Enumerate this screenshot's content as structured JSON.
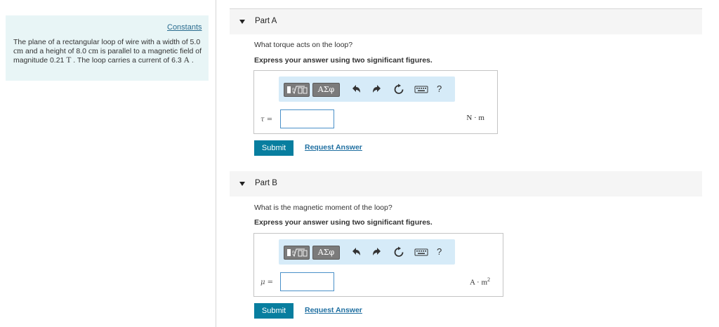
{
  "sidebar": {
    "constants_link": "Constants",
    "problem": {
      "t1": "The plane of a rectangular loop of wire with a width of 5.0",
      "u1": "cm",
      "t2": " and a height of 8.0 ",
      "u2": "cm",
      "t3": " is parallel to a magnetic field of magnitude 0.21 ",
      "u3": "T",
      "t4": " . The loop carries a current of 6.3 ",
      "u4": "A",
      "t5": " ."
    }
  },
  "parts": [
    {
      "title": "Part A",
      "question": "What torque acts on the loop?",
      "instruction": "Express your answer using two significant figures.",
      "variable_label": "τ =",
      "input_value": "",
      "unit": "N · m",
      "submit_label": "Submit",
      "request_label": "Request Answer"
    },
    {
      "title": "Part B",
      "question": "What is the magnetic moment of the loop?",
      "instruction": "Express your answer using two significant figures.",
      "variable_label": "μ =",
      "input_value": "",
      "unit_base": "A · m",
      "unit_exp": "2",
      "submit_label": "Submit",
      "request_label": "Request Answer"
    }
  ],
  "toolbar": {
    "greek_label": "ΑΣφ",
    "help_label": "?",
    "icons": [
      "templates-icon",
      "greek-symbols-icon",
      "undo-icon",
      "redo-icon",
      "reset-icon",
      "keyboard-icon",
      "help-icon"
    ]
  },
  "colors": {
    "panel_bg": "#e8f5f6",
    "toolbar_bg": "#d6ebf8",
    "submit_bg": "#087e9f",
    "link": "#1f6fa1"
  }
}
